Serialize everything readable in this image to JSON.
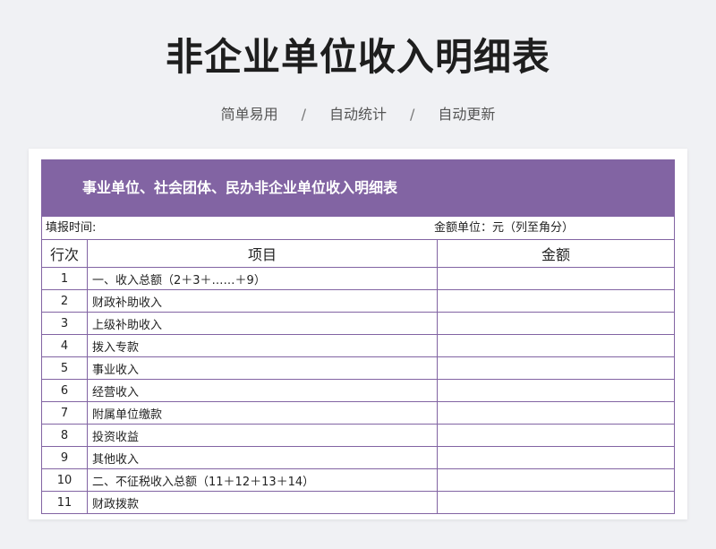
{
  "page": {
    "title": "非企业单位收入明细表",
    "features": [
      "简单易用",
      "自动统计",
      "自动更新"
    ],
    "separator": "/"
  },
  "sheet": {
    "header": "事业单位、社会团体、民办非企业单位收入明细表",
    "fill_time_label": "填报时间:",
    "unit_label": "金额单位：元（列至角分）",
    "columns": {
      "no": "行次",
      "item": "项目",
      "amount": "金额"
    },
    "rows": [
      {
        "no": "1",
        "item": "一、收入总额（2＋3＋……＋9）",
        "amount": ""
      },
      {
        "no": "2",
        "item": "财政补助收入",
        "amount": ""
      },
      {
        "no": "3",
        "item": "上级补助收入",
        "amount": ""
      },
      {
        "no": "4",
        "item": "拨入专款",
        "amount": ""
      },
      {
        "no": "5",
        "item": "事业收入",
        "amount": ""
      },
      {
        "no": "6",
        "item": "经营收入",
        "amount": ""
      },
      {
        "no": "7",
        "item": "附属单位缴款",
        "amount": ""
      },
      {
        "no": "8",
        "item": "投资收益",
        "amount": ""
      },
      {
        "no": "9",
        "item": "其他收入",
        "amount": ""
      },
      {
        "no": "10",
        "item": "二、不征税收入总额（11＋12＋13＋14）",
        "amount": ""
      },
      {
        "no": "11",
        "item": "财政拨款",
        "amount": ""
      }
    ]
  },
  "colors": {
    "accent": "#8264a3",
    "background": "#f0f1f4"
  }
}
